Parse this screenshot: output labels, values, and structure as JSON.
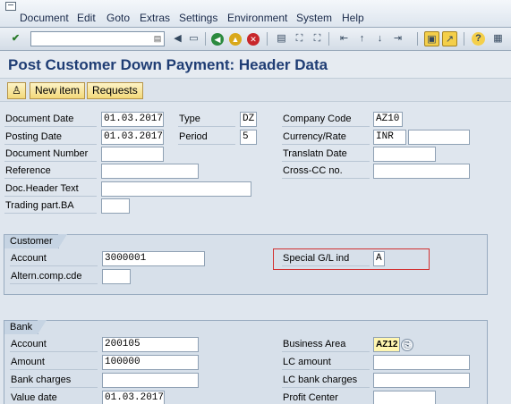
{
  "menu": {
    "items": [
      "Document",
      "Edit",
      "Goto",
      "Extras",
      "Settings",
      "Environment",
      "System",
      "Help"
    ]
  },
  "toolbar": {
    "command_field": "",
    "icons": [
      "enter-icon",
      "save-icon",
      "back-icon",
      "exit-icon",
      "cancel-icon",
      "print-icon",
      "find-icon",
      "find-next-icon",
      "first-page-icon",
      "previous-page-icon",
      "next-page-icon",
      "last-page-icon",
      "create-session-icon",
      "shortcut-icon",
      "help-icon",
      "customize-layout-icon"
    ]
  },
  "page": {
    "title": "Post Customer Down Payment: Header Data"
  },
  "app_toolbar": {
    "new_item": "New item",
    "requests": "Requests"
  },
  "header": {
    "document_date": {
      "label": "Document Date",
      "value": "01.03.2017"
    },
    "type": {
      "label": "Type",
      "value": "DZ"
    },
    "company_code": {
      "label": "Company Code",
      "value": "AZ10"
    },
    "posting_date": {
      "label": "Posting Date",
      "value": "01.03.2017"
    },
    "period": {
      "label": "Period",
      "value": "5"
    },
    "currency_rate": {
      "label": "Currency/Rate",
      "value": "INR",
      "rate": ""
    },
    "document_number": {
      "label": "Document Number",
      "value": ""
    },
    "translation_date": {
      "label": "Translatn Date",
      "value": ""
    },
    "reference": {
      "label": "Reference",
      "value": ""
    },
    "cross_cc": {
      "label": "Cross-CC no.",
      "value": ""
    },
    "doc_header_text": {
      "label": "Doc.Header Text",
      "value": ""
    },
    "trading_part_ba": {
      "label": "Trading part.BA",
      "value": ""
    }
  },
  "customer": {
    "title": "Customer",
    "account": {
      "label": "Account",
      "value": "3000001"
    },
    "special_gl_ind": {
      "label": "Special G/L ind",
      "value": "A"
    },
    "altern_comp_cde": {
      "label": "Altern.comp.cde",
      "value": ""
    }
  },
  "bank": {
    "title": "Bank",
    "account": {
      "label": "Account",
      "value": "200105"
    },
    "business_area": {
      "label": "Business Area",
      "value": "AZ12"
    },
    "amount": {
      "label": "Amount",
      "value": "100000"
    },
    "lc_amount": {
      "label": "LC amount",
      "value": ""
    },
    "bank_charges": {
      "label": "Bank charges",
      "value": ""
    },
    "lc_bank_charges": {
      "label": "LC bank charges",
      "value": ""
    },
    "value_date": {
      "label": "Value date",
      "value": "01.03.2017"
    },
    "profit_center": {
      "label": "Profit Center",
      "value": ""
    }
  },
  "colors": {
    "title_blue": "#1f3d74",
    "highlight_red": "#d23030",
    "app_button_yellow": "#f3d97a"
  }
}
